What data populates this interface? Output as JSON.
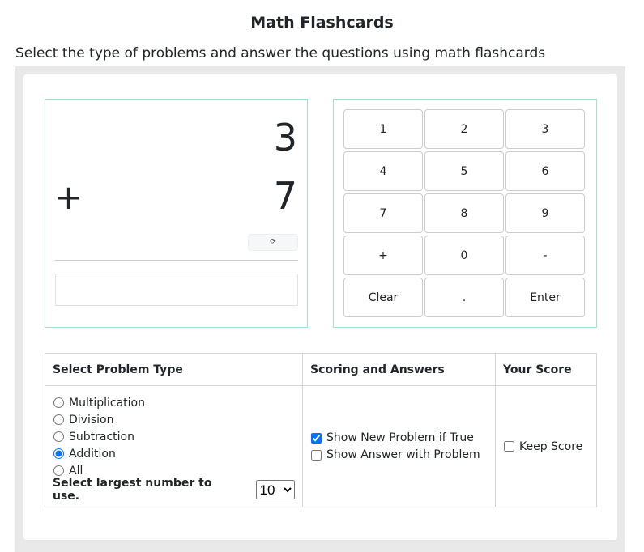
{
  "title": "Math Flashcards",
  "subtitle": "Select the type of problems and answer the questions using math flashcards",
  "card": {
    "top_number": "3",
    "operator": "+",
    "bottom_number": "7",
    "refresh_icon": "⟳",
    "answer_value": ""
  },
  "keypad": [
    "1",
    "2",
    "3",
    "4",
    "5",
    "6",
    "7",
    "8",
    "9",
    "+",
    "0",
    "-",
    "Clear",
    ".",
    "Enter"
  ],
  "table": {
    "headers": [
      "Select Problem Type",
      "Scoring and Answers",
      "Your Score"
    ],
    "problem_types": [
      {
        "label": "Multiplication",
        "checked": false
      },
      {
        "label": "Division",
        "checked": false
      },
      {
        "label": "Subtraction",
        "checked": false
      },
      {
        "label": "Addition",
        "checked": true
      },
      {
        "label": "All",
        "checked": false
      }
    ],
    "largest_label": "Select largest number to use.",
    "largest_value": "10",
    "scoring": [
      {
        "label": "Show New Problem if True",
        "checked": true
      },
      {
        "label": "Show Answer with Problem",
        "checked": false
      }
    ],
    "keep_score": {
      "label": "Keep Score",
      "checked": false
    }
  }
}
